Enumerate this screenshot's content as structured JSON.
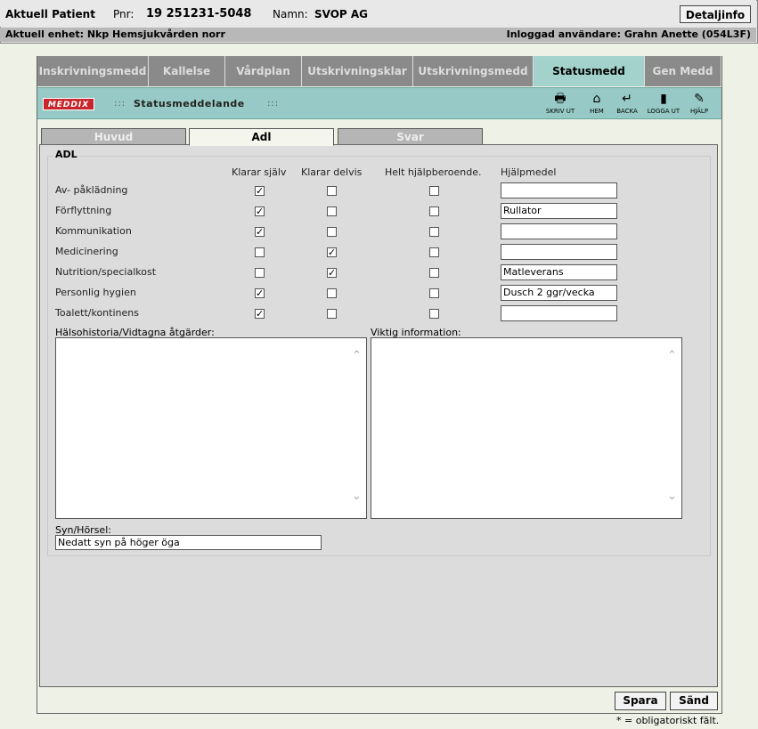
{
  "patient": {
    "current_label": "Aktuell Patient",
    "pnr_label": "Pnr:",
    "pnr_value": "19 251231-5048",
    "name_label": "Namn:",
    "name_value": "SVOP AG",
    "detail_button": "Detaljinfo",
    "unit_text": "Aktuell enhet: Nkp Hemsjukvården norr",
    "user_text": "Inloggad användare: Grahn Anette (054L3F)"
  },
  "tabs": [
    "Inskrivningsmedd",
    "Kallelse",
    "Vårdplan",
    "Utskrivningsklar",
    "Utskrivningsmedd",
    "Statusmedd",
    "Gen Medd"
  ],
  "active_tab": "Statusmedd",
  "banner": {
    "logo_text": "MEDDIX",
    "dots": ":::",
    "title": "Statusmeddelande",
    "tools": [
      {
        "icon": "printer-icon",
        "glyph": "🖶",
        "label": "SKRIV UT"
      },
      {
        "icon": "home-icon",
        "glyph": "⌂",
        "label": "HEM"
      },
      {
        "icon": "back-icon",
        "glyph": "↵",
        "label": "BACKA"
      },
      {
        "icon": "logout-icon",
        "glyph": "▮",
        "label": "LOGGA UT"
      },
      {
        "icon": "help-icon",
        "glyph": "✎",
        "label": "HJÄLP"
      }
    ]
  },
  "subtabs": [
    "Huvud",
    "Adl",
    "Svar"
  ],
  "active_subtab": "Adl",
  "adl": {
    "legend": "ADL",
    "col_headers": [
      "Klarar själv",
      "Klarar delvis",
      "Helt hjälpberoende.",
      "Hjälpmedel"
    ],
    "rows": [
      {
        "label": "Av- påklädning",
        "self": true,
        "partial": false,
        "dependent": false,
        "aid": ""
      },
      {
        "label": "Förflyttning",
        "self": true,
        "partial": false,
        "dependent": false,
        "aid": "Rullator"
      },
      {
        "label": "Kommunikation",
        "self": true,
        "partial": false,
        "dependent": false,
        "aid": ""
      },
      {
        "label": "Medicinering",
        "self": false,
        "partial": true,
        "dependent": false,
        "aid": ""
      },
      {
        "label": "Nutrition/specialkost",
        "self": false,
        "partial": true,
        "dependent": false,
        "aid": "Matleverans"
      },
      {
        "label": "Personlig hygien",
        "self": true,
        "partial": false,
        "dependent": false,
        "aid": "Dusch 2 ggr/vecka"
      },
      {
        "label": "Toalett/kontinens",
        "self": true,
        "partial": false,
        "dependent": false,
        "aid": ""
      }
    ],
    "health_history_label": "Hälsohistoria/Vidtagna åtgärder:",
    "health_history_value": "",
    "important_info_label": "Viktig information:",
    "important_info_value": "",
    "vision_label": "Syn/Hörsel:",
    "vision_value": "Nedatt syn på höger öga"
  },
  "buttons": {
    "save": "Spara",
    "send": "Sänd"
  },
  "footnote": "* = obligatoriskt fält."
}
